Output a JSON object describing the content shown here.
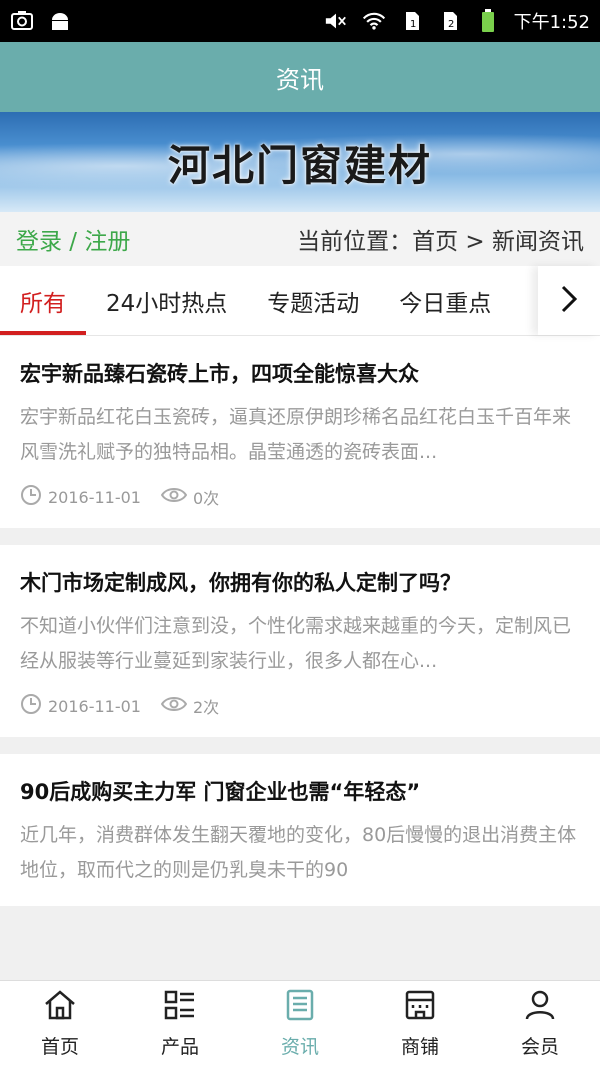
{
  "status_bar": {
    "time": "下午1:52"
  },
  "header": {
    "title": "资讯"
  },
  "banner": {
    "title": "河北门窗建材"
  },
  "login_bar": {
    "login_text": "登录 / 注册",
    "location_text": "当前位置：首页 > 新闻资讯"
  },
  "tabs": [
    {
      "label": "所有"
    },
    {
      "label": "24小时热点"
    },
    {
      "label": "专题活动"
    },
    {
      "label": "今日重点"
    }
  ],
  "news": [
    {
      "title": "宏宇新品臻石瓷砖上市，四项全能惊喜大众",
      "desc": "宏宇新品红花白玉瓷砖，逼真还原伊朗珍稀名品红花白玉千百年来风雪洗礼赋予的独特品相。晶莹通透的瓷砖表面...",
      "date": "2016-11-01",
      "views": "0次"
    },
    {
      "title": "木门市场定制成风，你拥有你的私人定制了吗？",
      "desc": "不知道小伙伴们注意到没，个性化需求越来越重的今天，定制风已经从服装等行业蔓延到家装行业，很多人都在心...",
      "date": "2016-11-01",
      "views": "2次"
    },
    {
      "title": "90后成购买主力军 门窗企业也需“年轻态”",
      "desc": "近几年，消费群体发生翻天覆地的变化，80后慢慢的退出消费主体地位，取而代之的则是仍乳臭未干的90",
      "date": "",
      "views": ""
    }
  ],
  "bottom_nav": [
    {
      "label": "首页",
      "icon": "home-icon"
    },
    {
      "label": "产品",
      "icon": "list-icon"
    },
    {
      "label": "资讯",
      "icon": "news-icon"
    },
    {
      "label": "商铺",
      "icon": "shop-icon"
    },
    {
      "label": "会员",
      "icon": "user-icon"
    }
  ],
  "colors": {
    "header": "#6aadac",
    "active_tab": "#d21f1f",
    "login_link": "#3da84a"
  }
}
